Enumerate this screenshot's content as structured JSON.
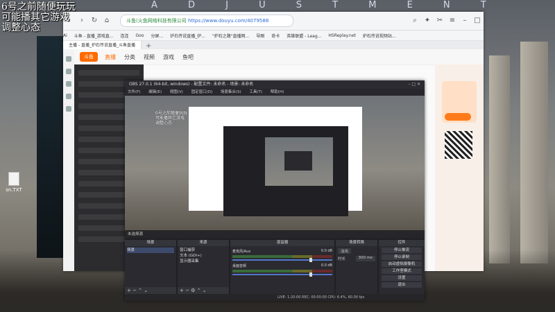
{
  "overlay": {
    "line1": "6号之前随便玩玩",
    "line2": "可能播其它游戏",
    "line3": "调整心态"
  },
  "watermark": "A D J U S T M E N T",
  "desktop": {
    "file_label": "sn.TXT"
  },
  "browser": {
    "address_site": "斗鱼(火鱼网络科技有限公司",
    "address_url": "https://www.douyu.com/4079588",
    "bookmarks": [
      "Ai",
      "斗鱼 - 直播_游戏直...",
      "连连",
      "Goo",
      "分屏...",
      "炉石传说直播_炉...",
      "\"炉石之路\"直播网...",
      "导图",
      "奇卡",
      "英雄联盟 - Leag...",
      "HSReplay.net",
      "炉石传说视频站..."
    ],
    "tab_label": "主播 - 直播_炉石传说直播_斗鱼直播",
    "site_nav": [
      "直播",
      "分类",
      "视频",
      "游戏",
      "鱼吧"
    ],
    "site_logo": "斗鱼"
  },
  "obs": {
    "title": "OBS 27.0.1 (64-bit, windows) - 配置文件: 未命名 - 场景: 未命名",
    "menu": [
      "文件(F)",
      "编辑(E)",
      "视图(V)",
      "固定窗口(D)",
      "场景集合(S)",
      "工具(T)",
      "帮助(H)"
    ],
    "preview_text": "6号之前随便玩玩\n可能播其它游戏\n调整心态",
    "toolbar_label": "未选择源",
    "docks": {
      "scenes": {
        "title": "场景",
        "items": [
          "场景"
        ]
      },
      "sources": {
        "title": "来源",
        "items": [
          "窗口捕获",
          "文本 (GDI+)",
          "显示器采集"
        ]
      },
      "mixer": {
        "title": "混音器",
        "channels": [
          {
            "name": "麦克风/Aux",
            "level": "0.0 dB"
          },
          {
            "name": "桌面音频",
            "level": "0.0 dB"
          }
        ]
      },
      "transitions": {
        "title": "场景转换",
        "type": "淡出",
        "duration_label": "时长",
        "duration": "300 ms"
      },
      "controls": {
        "title": "控件",
        "buttons": [
          "停止推流",
          "停止录制",
          "启动虚拟摄像机",
          "工作室模式",
          "设置",
          "退出"
        ]
      }
    },
    "status": "LIVE: 1:20:00  REC: 00:00:00  CPU: 6.4%, 60.00 fps"
  },
  "colors": {
    "brand_orange": "#ff6a00",
    "obs_bg": "#1f1f24"
  }
}
